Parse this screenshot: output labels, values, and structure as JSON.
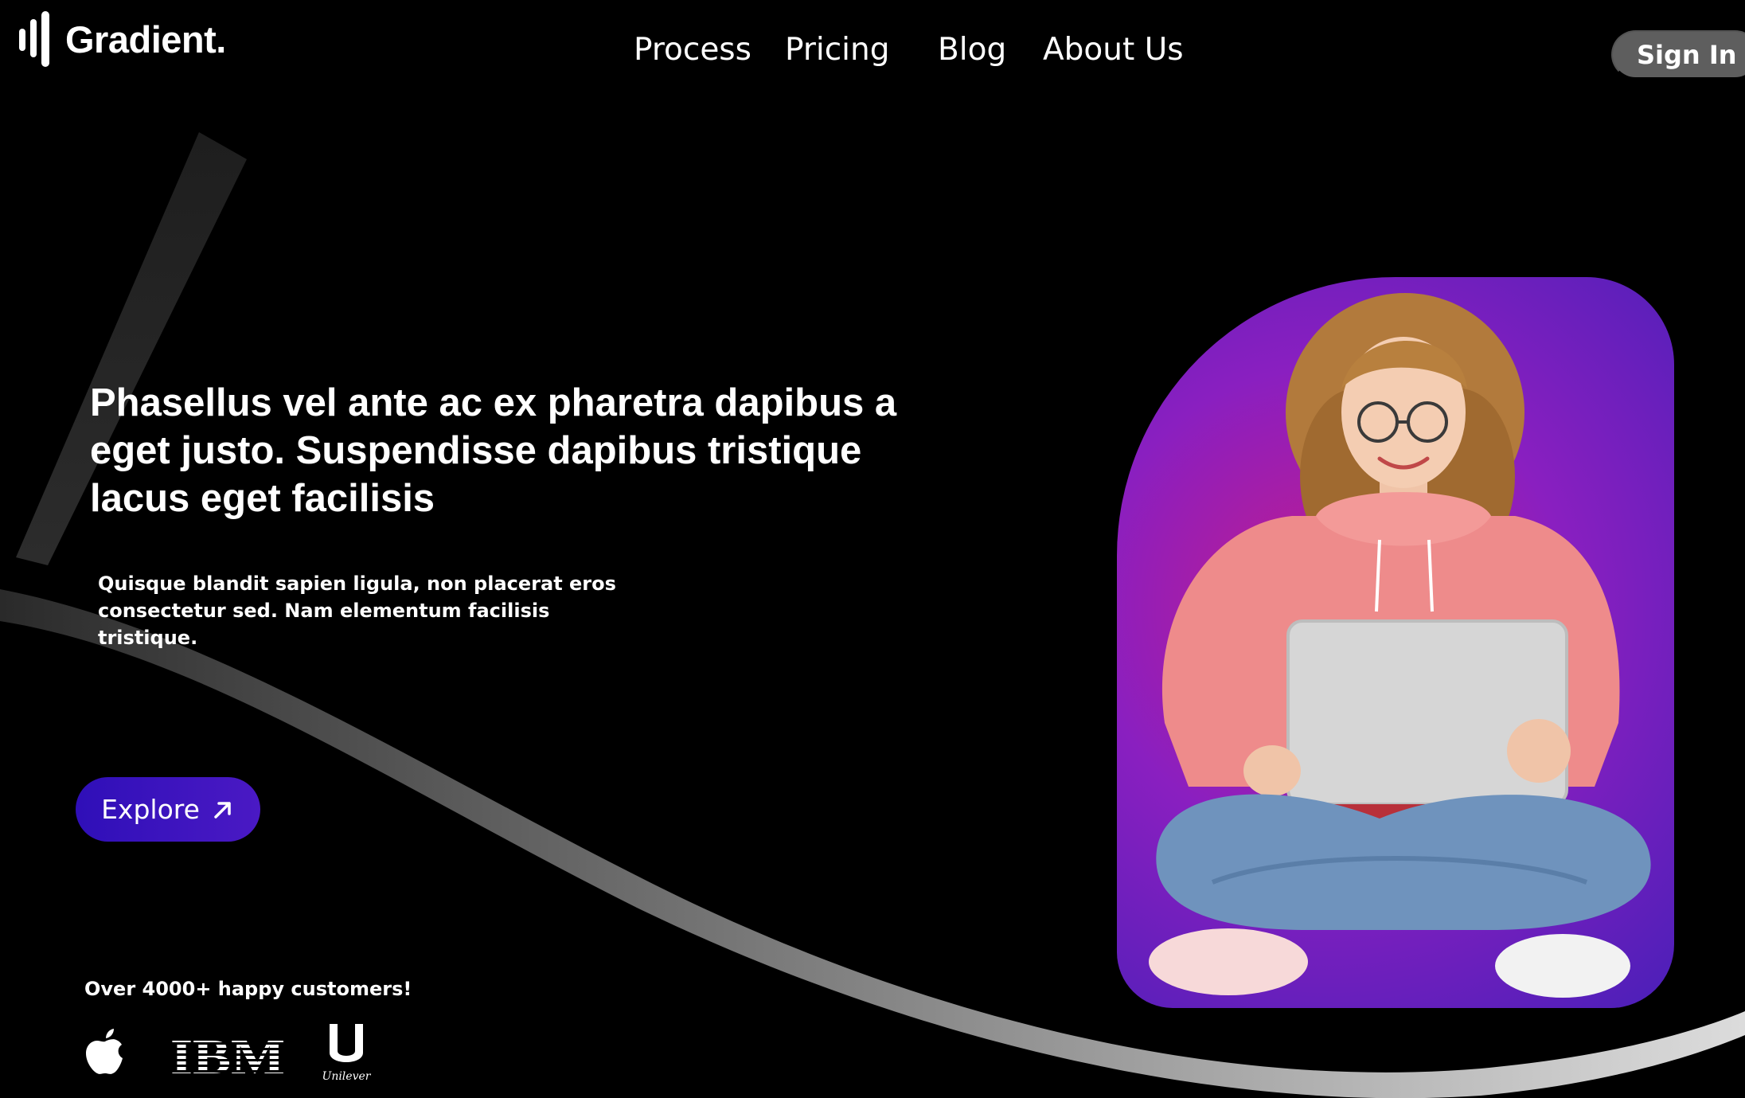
{
  "brand": {
    "name": "Gradient."
  },
  "nav": {
    "links": [
      {
        "label": "Process"
      },
      {
        "label": "Pricing"
      },
      {
        "label": "Blog"
      },
      {
        "label": "About Us"
      }
    ],
    "signin_label": "Sign In"
  },
  "hero": {
    "title": "Phasellus vel ante ac ex pharetra dapibus a eget justo. Suspendisse dapibus tristique lacus eget facilisis",
    "subtitle": "Quisque blandit sapien ligula, non placerat eros consectetur sed. Nam elementum facilisis tristique.",
    "cta_label": "Explore",
    "cta_icon": "arrow-up-right-icon"
  },
  "social_proof": {
    "text": "Over 4000+ happy customers!",
    "logos": [
      {
        "name": "apple-logo",
        "text": ""
      },
      {
        "name": "ibm-logo",
        "text": "IBM"
      },
      {
        "name": "unilever-logo",
        "text": "Unilever"
      }
    ]
  },
  "colors": {
    "background": "#000000",
    "accent": "#3a14c0",
    "signin_bg": "#5e5e5e",
    "photo_gradient": [
      "#c21c8e",
      "#8a1fc0",
      "#4a1fb8"
    ]
  }
}
